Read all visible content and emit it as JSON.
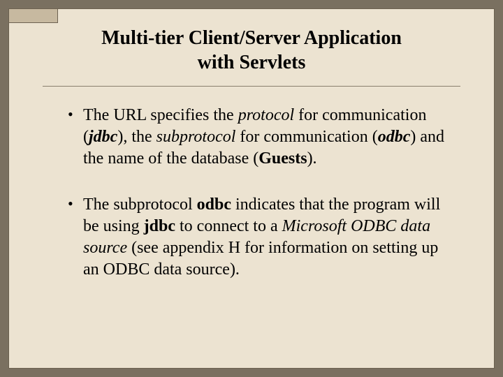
{
  "slide": {
    "title_line1": "Multi-tier Client/Server Application",
    "title_line2": "with Servlets",
    "bullets": [
      {
        "segments": [
          {
            "text": "The URL specifies the ",
            "style": "seg"
          },
          {
            "text": "protocol",
            "style": "ital"
          },
          {
            "text": " for communication (",
            "style": "seg"
          },
          {
            "text": "jdbc",
            "style": "bi"
          },
          {
            "text": "), the ",
            "style": "seg"
          },
          {
            "text": "subprotocol",
            "style": "ital"
          },
          {
            "text": " for communication (",
            "style": "seg"
          },
          {
            "text": "odbc",
            "style": "bi"
          },
          {
            "text": ") and the name of the database (",
            "style": "seg"
          },
          {
            "text": "Guests",
            "style": "bold"
          },
          {
            "text": ").",
            "style": "seg"
          }
        ]
      },
      {
        "segments": [
          {
            "text": "The subprotocol ",
            "style": "seg"
          },
          {
            "text": "odbc",
            "style": "bold"
          },
          {
            "text": " indicates that the program will be using ",
            "style": "seg"
          },
          {
            "text": "jdbc",
            "style": "bold"
          },
          {
            "text": " to connect to a ",
            "style": "seg"
          },
          {
            "text": "Microsoft ODBC data source",
            "style": "ital"
          },
          {
            "text": " (see appendix H for information on setting up an ODBC data source).",
            "style": "seg"
          }
        ]
      }
    ]
  }
}
